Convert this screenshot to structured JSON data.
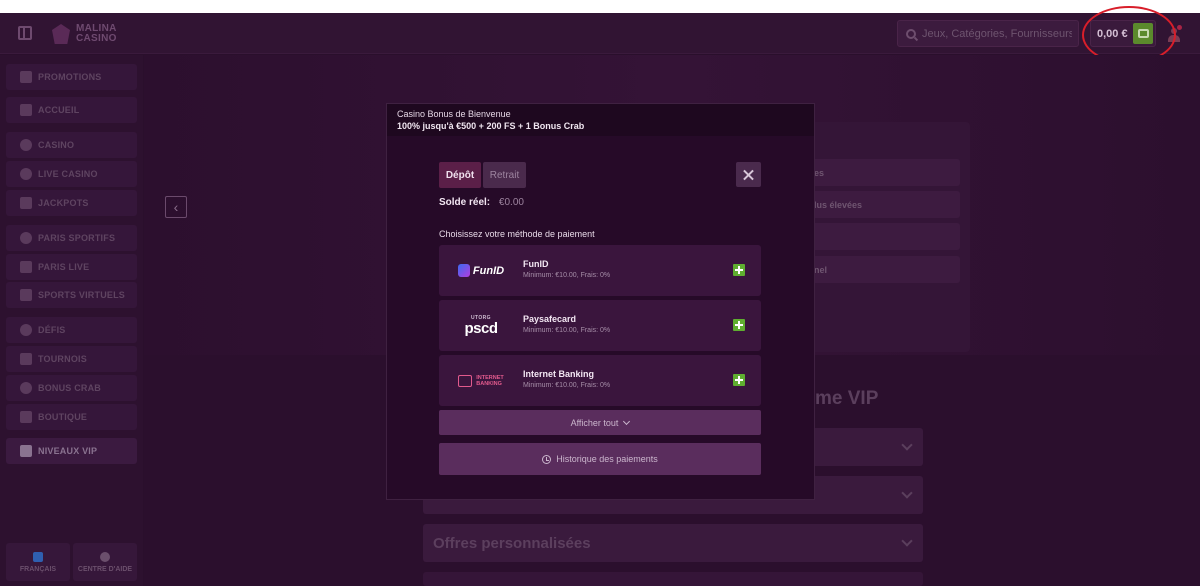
{
  "header": {
    "logo_line1": "MALINA",
    "logo_line2": "CASINO",
    "search_placeholder": "Jeux, Catégories, Fournisseurs",
    "balance": "0,00 €"
  },
  "sidebar": {
    "items": [
      {
        "label": "PROMOTIONS",
        "icon": "gift-icon"
      },
      {
        "label": "ACCUEIL",
        "icon": "home-icon"
      },
      {
        "label": "CASINO",
        "icon": "cherries-icon"
      },
      {
        "label": "LIVE CASINO",
        "icon": "chip-icon"
      },
      {
        "label": "JACKPOTS",
        "icon": "jackpot-icon"
      },
      {
        "label": "PARIS SPORTIFS",
        "icon": "soccer-ball-icon"
      },
      {
        "label": "PARIS LIVE",
        "icon": "live-icon"
      },
      {
        "label": "SPORTS VIRTUELS",
        "icon": "virtual-sports-icon"
      },
      {
        "label": "DÉFIS",
        "icon": "challenge-icon"
      },
      {
        "label": "TOURNOIS",
        "icon": "trophy-icon"
      },
      {
        "label": "BONUS CRAB",
        "icon": "claw-icon"
      },
      {
        "label": "BOUTIQUE",
        "icon": "shop-icon"
      },
      {
        "label": "NIVEAUX VIP",
        "icon": "diamond-icon"
      }
    ],
    "footer": {
      "language": "FRANÇAIS",
      "help": "CENTRE D'AIDE"
    }
  },
  "background": {
    "panel_rows": [
      "es",
      "lus élevées",
      "",
      "nel"
    ],
    "vip_title": "me VIP",
    "accordion_title": "Offres personnalisées"
  },
  "modal": {
    "header_title": "Casino Bonus de Bienvenue",
    "header_subtitle": "100% jusqu'à €500 + 200 FS + 1 Bonus Crab",
    "tabs": {
      "deposit": "Dépôt",
      "withdraw": "Retrait"
    },
    "balance_label": "Solde réel:",
    "balance_value": "€0.00",
    "method_heading": "Choisissez votre méthode de paiement",
    "methods": [
      {
        "name": "FunID",
        "details": "Minimum: €10.00, Frais: 0%",
        "logo_text": "FunID"
      },
      {
        "name": "Paysafecard",
        "details": "Minimum: €10.00, Frais: 0%",
        "logo_small": "UTORG",
        "logo_text": "pscd"
      },
      {
        "name": "Internet Banking",
        "details": "Minimum: €10.00, Frais: 0%",
        "logo_line1": "INTERNET",
        "logo_line2": "BANKING"
      }
    ],
    "show_all": "Afficher tout",
    "history": "Historique des paiements"
  },
  "colors": {
    "accent_green": "#5fae30",
    "annotation_red": "#d81e2a",
    "active_tab": "#5b1f48"
  }
}
